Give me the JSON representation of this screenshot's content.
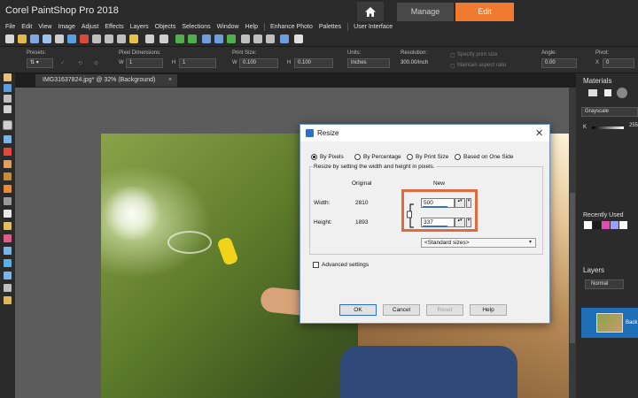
{
  "app": {
    "title": "Corel PaintShop Pro 2018",
    "tabs": {
      "manage": "Manage",
      "edit": "Edit"
    }
  },
  "menu": [
    "File",
    "Edit",
    "View",
    "Image",
    "Adjust",
    "Effects",
    "Layers",
    "Objects",
    "Selections",
    "Window",
    "Help",
    "Enhance Photo",
    "Palettes",
    "User Interface"
  ],
  "tool_options": {
    "presets_label": "Presets:",
    "pixel_dimensions_label": "Pixel Dimensions:",
    "pixel_w_label": "W",
    "pixel_w_value": "1",
    "pixel_h_label": "H",
    "pixel_h_value": "1",
    "print_size_label": "Print Size:",
    "print_w_label": "W",
    "print_w_value": "0.100",
    "print_h_label": "H",
    "print_h_value": "0.100",
    "units_label": "Units:",
    "units_value": "Inches",
    "resolution_label": "Resolution:",
    "resolution_value": "300.00/inch",
    "specify_print_size": "Specify print size",
    "maintain_aspect_ratio": "Maintain aspect ratio",
    "angle_label": "Angle:",
    "angle_value": "0.00",
    "pivot_label": "Pivot:",
    "pivot_x_label": "X",
    "pivot_x_value": "0"
  },
  "document": {
    "tab_label": "IMG31637824.jpg* @ 32% (Background)",
    "close_glyph": "×"
  },
  "materials": {
    "title": "Materials",
    "mode": "Grayscale",
    "k_label": "K",
    "k_value": "255",
    "recently_used": "Recently Used",
    "swatch_colors": [
      "#ffffff",
      "#1a1a1a",
      "#e04fb0",
      "#9aa0ff",
      "#ffffff"
    ]
  },
  "layers": {
    "title": "Layers",
    "blend_mode": "Normal",
    "layer_name": "Back"
  },
  "dialog": {
    "title": "Resize",
    "close_glyph": "✕",
    "modes": {
      "by_pixels": "By Pixels",
      "by_percentage": "By Percentage",
      "by_print_size": "By Print Size",
      "based_on_one_side": "Based on One Side"
    },
    "group_caption": "Resize by setting the width and height in pixels.",
    "original_header": "Original",
    "new_header": "New",
    "width_label": "Width:",
    "height_label": "Height:",
    "original_width": "2810",
    "original_height": "1893",
    "new_width": "500",
    "new_height": "337",
    "standard_sizes": "<Standard sizes>",
    "advanced_settings": "Advanced settings",
    "ok": "OK",
    "cancel": "Cancel",
    "reset": "Reset",
    "help": "Help"
  },
  "colors": {
    "accent_tab": "#f07a30",
    "highlight_box": "#e06a40",
    "layer_selected": "#1e6fb8"
  }
}
